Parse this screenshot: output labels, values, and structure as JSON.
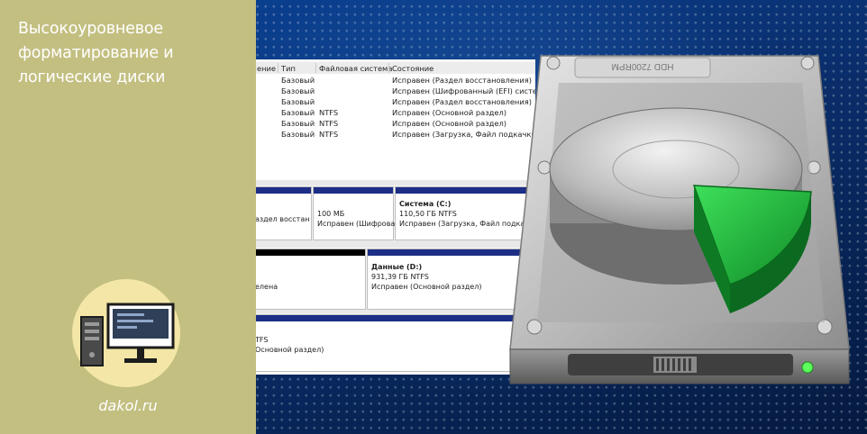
{
  "left_panel": {
    "title_lines": [
      "Высокоуровневое",
      "форматирование и",
      "логические диски"
    ],
    "site": "dakol.ru",
    "logo_icon": "computer-icon",
    "colors": {
      "background": "#c3bf81",
      "logo_circle": "#f3e6a6"
    }
  },
  "disk_management": {
    "columns": [
      "ение",
      "Тип",
      "Файловая система",
      "Состояние"
    ],
    "volumes": [
      {
        "type": "Базовый",
        "fs": "",
        "status": "Исправен (Раздел восстановления)"
      },
      {
        "type": "Базовый",
        "fs": "",
        "status": "Исправен (Шифрованный (EFI) системн"
      },
      {
        "type": "Базовый",
        "fs": "",
        "status": "Исправен (Раздел восстановления)"
      },
      {
        "type": "Базовый",
        "fs": "NTFS",
        "status": "Исправен (Основной раздел)"
      },
      {
        "type": "Базовый",
        "fs": "NTFS",
        "status": "Исправен (Основной раздел)"
      },
      {
        "type": "Базовый",
        "fs": "NTFS",
        "status": "Исправен (Загрузка, Файл подкачки, А"
      }
    ],
    "disk0": {
      "p1_status": "аздел восстан",
      "p2_size": "100 МБ",
      "p2_status": "Исправен (Шифрова",
      "p3_name": "Система  (C:)",
      "p3_size": "110,50 ГБ NTFS",
      "p3_status": "Исправен (Загрузка, Файл подкачк"
    },
    "disk1": {
      "p1_status": "елена",
      "p2_name": "Данные  (D:)",
      "p2_size": "931,39 ГБ NTFS",
      "p2_status": "Исправен (Основной раздел)"
    },
    "disk2": {
      "fs": "TFS",
      "status": "Основной раздел)"
    }
  },
  "hdd": {
    "label": "HDD 7200RPM",
    "colors": {
      "slice": "#1fb43a",
      "led": "#5cff5c"
    }
  }
}
